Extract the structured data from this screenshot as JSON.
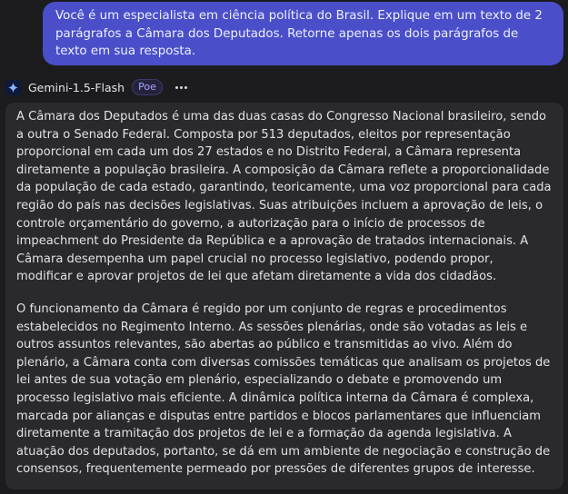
{
  "user_message": {
    "text": "Você é um especialista em ciência política do Brasil. Explique em um texto de 2 parágrafos a Câmara dos Deputados. Retorne apenas os dois parágrafos de texto em sua resposta."
  },
  "bot": {
    "name": "Gemini-1.5-Flash",
    "badge": "Poe",
    "avatar_icon": "gemini-sparkle-icon",
    "more_icon": "more-horizontal-icon"
  },
  "response": {
    "paragraphs": [
      "A Câmara dos Deputados é uma das duas casas do Congresso Nacional brasileiro, sendo a outra o Senado Federal. Composta por 513 deputados, eleitos por representação proporcional em cada um dos 27 estados e no Distrito Federal, a Câmara representa diretamente a população brasileira. A composição da Câmara reflete a proporcionalidade da população de cada estado, garantindo, teoricamente, uma voz proporcional para cada região do país nas decisões legislativas. Suas atribuições incluem a aprovação de leis, o controle orçamentário do governo, a autorização para o início de processos de impeachment do Presidente da República e a aprovação de tratados internacionais. A Câmara desempenha um papel crucial no processo legislativo, podendo propor, modificar e aprovar projetos de lei que afetam diretamente a vida dos cidadãos.",
      "O funcionamento da Câmara é regido por um conjunto de regras e procedimentos estabelecidos no Regimento Interno. As sessões plenárias, onde são votadas as leis e outros assuntos relevantes, são abertas ao público e transmitidas ao vivo. Além do plenário, a Câmara conta com diversas comissões temáticas que analisam os projetos de lei antes de sua votação em plenário, especializando o debate e promovendo um processo legislativo mais eficiente. A dinâmica política interna da Câmara é complexa, marcada por alianças e disputas entre partidos e blocos parlamentares que influenciam diretamente a tramitação dos projetos de lei e a formação da agenda legislativa. A atuação dos deputados, portanto, se dá em um ambiente de negociação e construção de consensos, frequentemente permeado por pressões de diferentes grupos de interesse."
    ]
  }
}
